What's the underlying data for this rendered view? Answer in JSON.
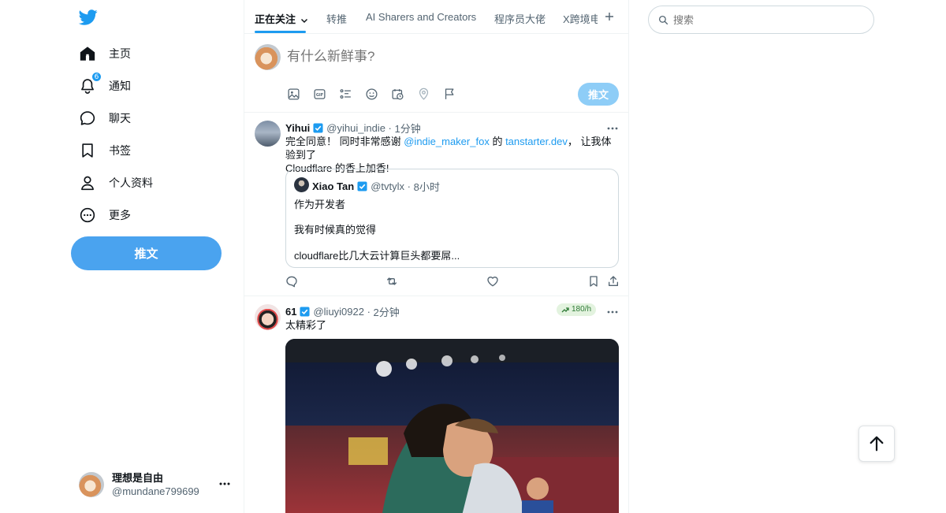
{
  "sidebar": {
    "items": [
      {
        "label": "主页",
        "icon": "home-icon"
      },
      {
        "label": "通知",
        "icon": "bell-icon",
        "badge": "6"
      },
      {
        "label": "聊天",
        "icon": "chat-icon"
      },
      {
        "label": "书签",
        "icon": "bookmark-icon"
      },
      {
        "label": "个人资料",
        "icon": "profile-icon"
      },
      {
        "label": "更多",
        "icon": "more-circle-icon"
      }
    ],
    "post_label": "推文",
    "account": {
      "name": "理想是自由",
      "handle": "@mundane799699"
    }
  },
  "tabs": [
    "正在关注",
    "转推",
    "AI Sharers and Creators",
    "程序员大佬",
    "X跨境电"
  ],
  "composer": {
    "placeholder": "有什么新鲜事?",
    "post_label": "推文"
  },
  "tweets": [
    {
      "name": "Yihui",
      "handle": "@yihui_indie",
      "time": "1分钟",
      "text_part1": "完全同意！ 同时非常感谢 ",
      "mention": "@indie_maker_fox",
      "text_part2": " 的 ",
      "link": "tanstarter.dev",
      "text_part3": "， 让我体验到了",
      "text_line2": "Cloudflare 的香上加香!",
      "quote": {
        "name": "Xiao Tan",
        "handle": "@tvtylx",
        "time": "8小时",
        "lines": [
          "作为开发者",
          "我有时候真的觉得",
          "cloudflare比几大云计算巨头都要屌..."
        ]
      }
    },
    {
      "name": "61",
      "handle": "@liuyi0922",
      "time": "2分钟",
      "text": "太精彩了",
      "rate": "180/h"
    }
  ],
  "search": {
    "placeholder": "搜索"
  },
  "colors": {
    "accent": "#1d9bf0",
    "post_button": "#4aa3ef",
    "text": "#0f1419",
    "muted": "#536471"
  }
}
